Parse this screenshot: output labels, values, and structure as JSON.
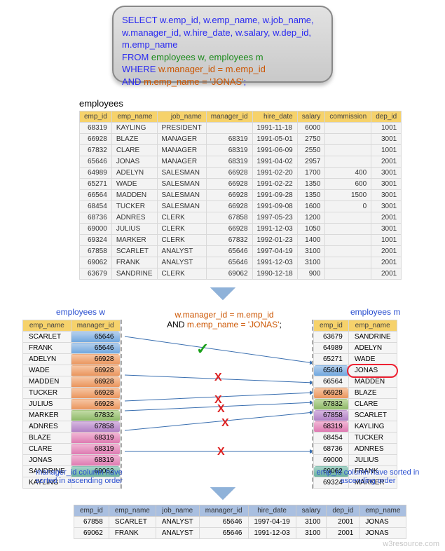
{
  "sql": {
    "select": "SELECT w.emp_id, w.emp_name, w.job_name, w.manager_id, w.hire_date, w.salary, w.dep_id, m.emp_name",
    "from_kw": "FROM ",
    "from_tbl": "employees w, employees m",
    "where_kw": "WHERE ",
    "cond1": "w.manager_id = m.emp_id",
    "and_kw": "   AND ",
    "cond2": "m.emp_name = 'JONAS'",
    "semi": ";"
  },
  "labels": {
    "employees": "employees",
    "employees_w": "employees w",
    "employees_m": "employees m",
    "note_w": "manager_id column have sorted in ascending order",
    "note_m": "emp_id column have sorted in ascending order",
    "watermark": "w3resource.com"
  },
  "mid": {
    "line1a": "w.manager_id = m.emp_id",
    "line2a": "AND ",
    "line2b": "m.emp_name = 'JONAS'",
    "semi": ";"
  },
  "emp_header": [
    "emp_id",
    "emp_name",
    "job_name",
    "manager_id",
    "hire_date",
    "salary",
    "commission",
    "dep_id"
  ],
  "emp_rows": [
    [
      "68319",
      "KAYLING",
      "PRESIDENT",
      "",
      "1991-11-18",
      "6000",
      "",
      "1001"
    ],
    [
      "66928",
      "BLAZE",
      "MANAGER",
      "68319",
      "1991-05-01",
      "2750",
      "",
      "3001"
    ],
    [
      "67832",
      "CLARE",
      "MANAGER",
      "68319",
      "1991-06-09",
      "2550",
      "",
      "1001"
    ],
    [
      "65646",
      "JONAS",
      "MANAGER",
      "68319",
      "1991-04-02",
      "2957",
      "",
      "2001"
    ],
    [
      "64989",
      "ADELYN",
      "SALESMAN",
      "66928",
      "1991-02-20",
      "1700",
      "400",
      "3001"
    ],
    [
      "65271",
      "WADE",
      "SALESMAN",
      "66928",
      "1991-02-22",
      "1350",
      "600",
      "3001"
    ],
    [
      "66564",
      "MADDEN",
      "SALESMAN",
      "66928",
      "1991-09-28",
      "1350",
      "1500",
      "3001"
    ],
    [
      "68454",
      "TUCKER",
      "SALESMAN",
      "66928",
      "1991-09-08",
      "1600",
      "0",
      "3001"
    ],
    [
      "68736",
      "ADNRES",
      "CLERK",
      "67858",
      "1997-05-23",
      "1200",
      "",
      "2001"
    ],
    [
      "69000",
      "JULIUS",
      "CLERK",
      "66928",
      "1991-12-03",
      "1050",
      "",
      "3001"
    ],
    [
      "69324",
      "MARKER",
      "CLERK",
      "67832",
      "1992-01-23",
      "1400",
      "",
      "1001"
    ],
    [
      "67858",
      "SCARLET",
      "ANALYST",
      "65646",
      "1997-04-19",
      "3100",
      "",
      "2001"
    ],
    [
      "69062",
      "FRANK",
      "ANALYST",
      "65646",
      "1991-12-03",
      "3100",
      "",
      "2001"
    ],
    [
      "63679",
      "SANDRINE",
      "CLERK",
      "69062",
      "1990-12-18",
      "900",
      "",
      "2001"
    ]
  ],
  "w_header": [
    "emp_name",
    "manager_id"
  ],
  "w_rows": [
    {
      "name": "SCARLET",
      "mid": "65646",
      "cls": "c-blue"
    },
    {
      "name": "FRANK",
      "mid": "65646",
      "cls": "c-blue"
    },
    {
      "name": "ADELYN",
      "mid": "66928",
      "cls": "c-orange"
    },
    {
      "name": "WADE",
      "mid": "66928",
      "cls": "c-orange"
    },
    {
      "name": "MADDEN",
      "mid": "66928",
      "cls": "c-orange"
    },
    {
      "name": "TUCKER",
      "mid": "66928",
      "cls": "c-orange"
    },
    {
      "name": "JULIUS",
      "mid": "66928",
      "cls": "c-orange"
    },
    {
      "name": "MARKER",
      "mid": "67832",
      "cls": "c-green"
    },
    {
      "name": "ADNRES",
      "mid": "67858",
      "cls": "c-purple"
    },
    {
      "name": "BLAZE",
      "mid": "68319",
      "cls": "c-pink"
    },
    {
      "name": "CLARE",
      "mid": "68319",
      "cls": "c-pink"
    },
    {
      "name": "JONAS",
      "mid": "68319",
      "cls": "c-pink"
    },
    {
      "name": "SANDRINE",
      "mid": "69062",
      "cls": "c-teal"
    },
    {
      "name": "KAYLING",
      "mid": "",
      "cls": ""
    }
  ],
  "m_header": [
    "emp_id",
    "emp_name"
  ],
  "m_rows": [
    {
      "id": "63679",
      "name": "SANDRINE",
      "cls": ""
    },
    {
      "id": "64989",
      "name": "ADELYN",
      "cls": ""
    },
    {
      "id": "65271",
      "name": "WADE",
      "cls": ""
    },
    {
      "id": "65646",
      "name": "JONAS",
      "cls": "c-blue",
      "ring": true
    },
    {
      "id": "66564",
      "name": "MADDEN",
      "cls": ""
    },
    {
      "id": "66928",
      "name": "BLAZE",
      "cls": "c-orange"
    },
    {
      "id": "67832",
      "name": "CLARE",
      "cls": "c-green"
    },
    {
      "id": "67858",
      "name": "SCARLET",
      "cls": "c-purple"
    },
    {
      "id": "68319",
      "name": "KAYLING",
      "cls": "c-pink"
    },
    {
      "id": "68454",
      "name": "TUCKER",
      "cls": ""
    },
    {
      "id": "68736",
      "name": "ADNRES",
      "cls": ""
    },
    {
      "id": "69000",
      "name": "JULIUS",
      "cls": ""
    },
    {
      "id": "69062",
      "name": "FRANK",
      "cls": "c-teal"
    },
    {
      "id": "69324",
      "name": "MARKER",
      "cls": ""
    }
  ],
  "res_header": [
    "emp_id",
    "emp_name",
    "job_name",
    "manager_id",
    "hire_date",
    "salary",
    "dep_id",
    "emp_name"
  ],
  "res_rows": [
    [
      "67858",
      "SCARLET",
      "ANALYST",
      "65646",
      "1997-04-19",
      "3100",
      "2001",
      "JONAS"
    ],
    [
      "69062",
      "FRANK",
      "ANALYST",
      "65646",
      "1991-12-03",
      "3100",
      "2001",
      "JONAS"
    ]
  ]
}
